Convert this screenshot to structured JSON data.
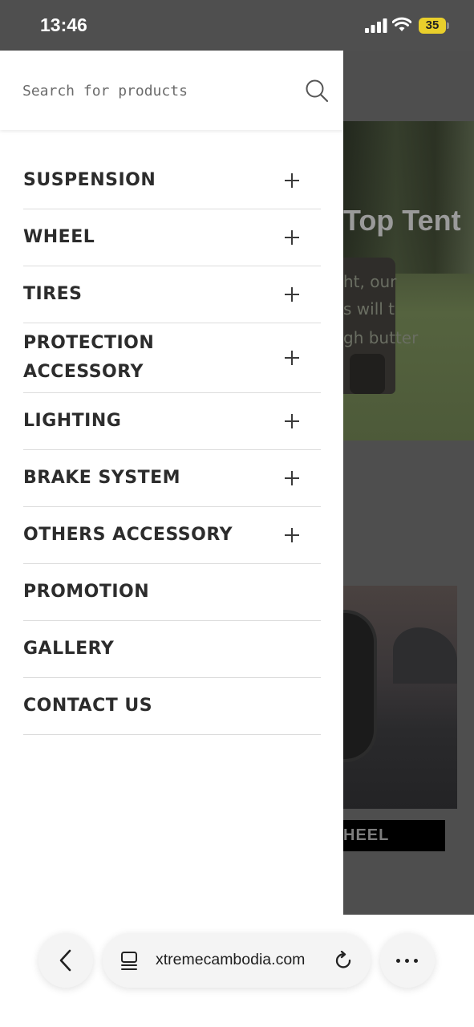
{
  "status_bar": {
    "time": "13:46",
    "battery_level": "35",
    "battery_color": "#e9cf2b"
  },
  "background_page": {
    "hero_title_partial": "Top Tent",
    "hero_text_lines": [
      "ht, our",
      "s will t",
      "gh butter"
    ],
    "card_button_partial": "HEEL"
  },
  "drawer": {
    "search": {
      "placeholder": "Search for products",
      "icon": "search-icon"
    },
    "menu_items": [
      {
        "label": "SUSPENSION",
        "expandable": true
      },
      {
        "label": "WHEEL",
        "expandable": true
      },
      {
        "label": "TIRES",
        "expandable": true
      },
      {
        "label": "PROTECTION ACCESSORY",
        "expandable": true
      },
      {
        "label": "LIGHTING",
        "expandable": true
      },
      {
        "label": "BRAKE SYSTEM",
        "expandable": true
      },
      {
        "label": "OTHERS ACCESSORY",
        "expandable": true
      },
      {
        "label": "PROMOTION",
        "expandable": false
      },
      {
        "label": "GALLERY",
        "expandable": false
      },
      {
        "label": "CONTACT US",
        "expandable": false
      }
    ]
  },
  "browser_bar": {
    "url": "xtremecambodia.com",
    "back_icon": "chevron-left-icon",
    "tabs_icon": "tabs-icon",
    "reload_icon": "reload-icon",
    "more_icon": "more-icon"
  }
}
